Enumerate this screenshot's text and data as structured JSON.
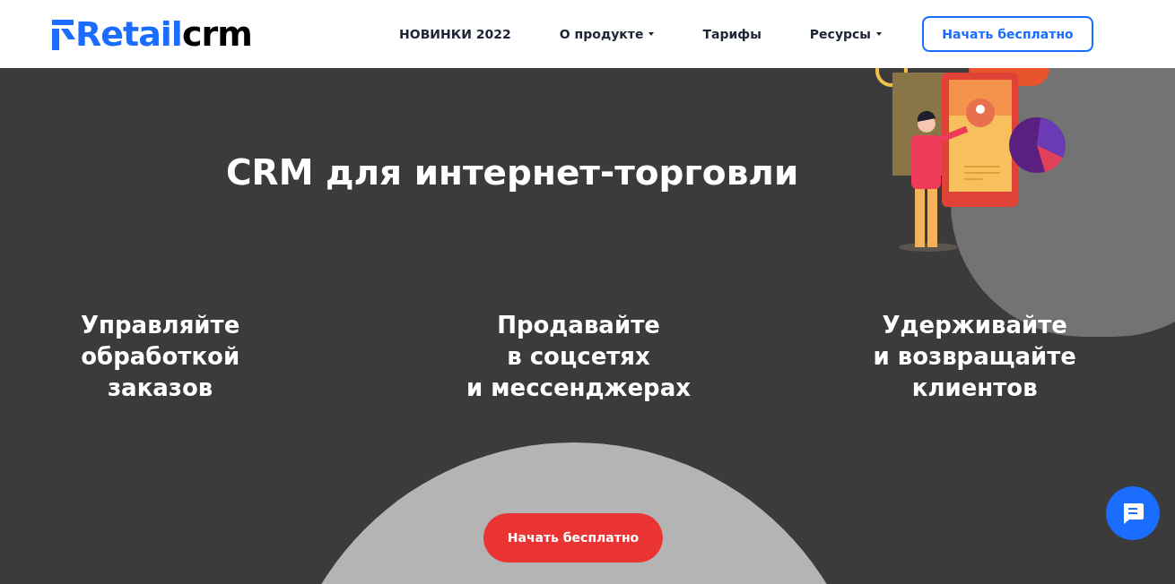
{
  "header": {
    "logo": {
      "brand": "Retail",
      "suffix": "crm"
    },
    "nav": [
      {
        "label": "НОВИНКИ 2022",
        "dropdown": false
      },
      {
        "label": "О продукте",
        "dropdown": true
      },
      {
        "label": "Тарифы",
        "dropdown": false
      },
      {
        "label": "Ресурсы",
        "dropdown": true
      }
    ],
    "cta": "Начать бесплатно"
  },
  "hero": {
    "title": "CRM для интернет-торговли",
    "features": [
      [
        "Управляйте",
        "обработкой",
        "заказов"
      ],
      [
        "Продавайте",
        "в соцсетях",
        "и мессенджерах"
      ],
      [
        "Удерживайте",
        "и возвращайте",
        "клиентов"
      ]
    ],
    "cta": "Начать бесплатно"
  }
}
